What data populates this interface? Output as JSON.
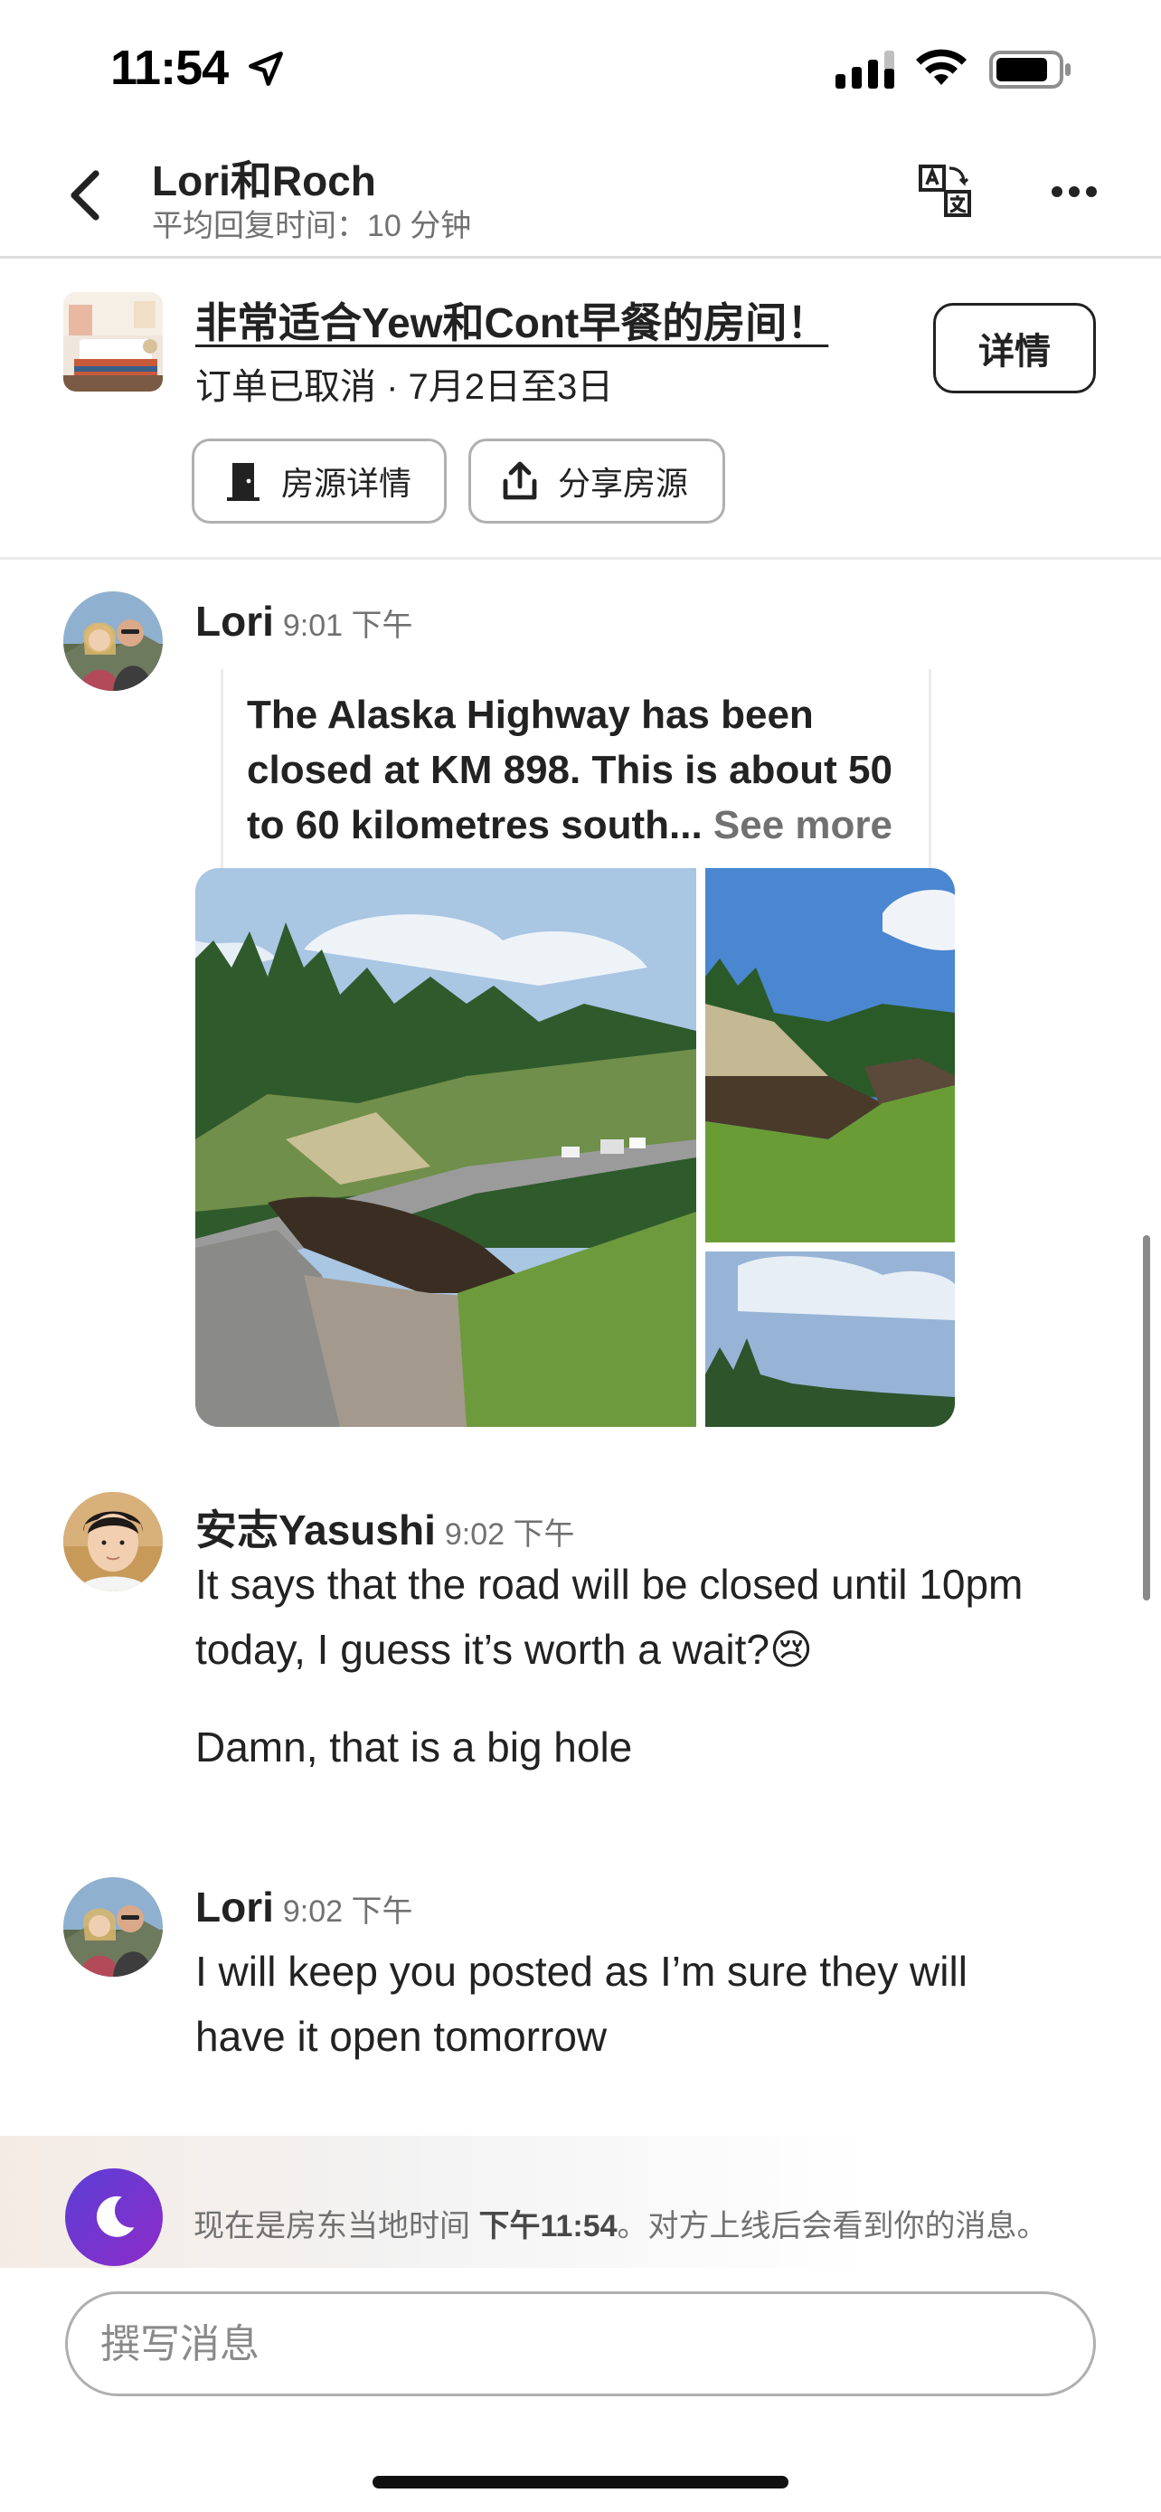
{
  "status_bar": {
    "time": "11:54"
  },
  "header": {
    "title": "Lori和Roch",
    "subtitle": "平均回复时间：10 分钟"
  },
  "listing": {
    "title": "非常适合Yew和Cont早餐的房间！",
    "status": "订单已取消 · 7月2日至3日",
    "details_button": "详情",
    "room_details_chip": "房源详情",
    "share_chip": "分享房源"
  },
  "messages": [
    {
      "sender": "Lori",
      "time": "9:01 下午",
      "preview_text": "The Alaska Highway has been closed at KM 898. This is about 50 to 60 kilometres south...",
      "see_more": "See more"
    },
    {
      "sender": "安志Yasushi",
      "time": "9:02 下午",
      "lines": [
        "It says that the road will be closed until 10pm today, I guess it’s worth a wait?😢",
        "Damn, that is a big hole"
      ]
    },
    {
      "sender": "Lori",
      "time": "9:02 下午",
      "lines": [
        "I will keep you posted as I’m sure they will have it open tomorrow"
      ]
    }
  ],
  "night_banner": {
    "prefix": "现在是房东当地时间 ",
    "time": "下午11:54",
    "suffix": "。对方上线后会看到你的消息。"
  },
  "composer": {
    "placeholder": "撰写消息"
  },
  "colors": {
    "text_primary": "#222222",
    "text_secondary": "#717171",
    "border": "#b0b0b0",
    "moon_gradient_start": "#5b3fd6",
    "moon_gradient_end": "#8e2bc8"
  },
  "icons": [
    "location-arrow-icon",
    "signal-icon",
    "wifi-icon",
    "battery-icon",
    "back-chevron-icon",
    "translate-icon",
    "more-icon",
    "door-icon",
    "share-icon",
    "moon-icon"
  ]
}
